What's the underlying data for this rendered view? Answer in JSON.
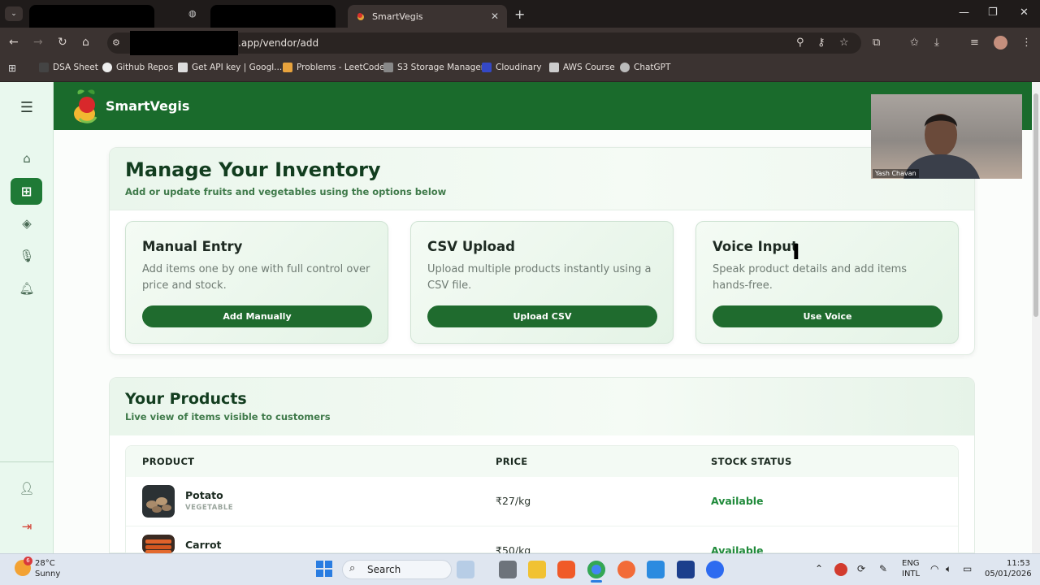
{
  "browser": {
    "tabs": [
      {
        "label": ""
      },
      {
        "label": ""
      },
      {
        "label": "SmartVegis"
      }
    ],
    "url": ".app/vendor/add",
    "bookmarks": [
      "DSA Sheet",
      "Github Repos",
      "Get API key | Googl...",
      "Problems - LeetCode",
      "S3 Storage Manager",
      "Cloudinary",
      "AWS Course",
      "ChatGPT"
    ]
  },
  "app": {
    "brand": "SmartVegis",
    "inventory": {
      "title": "Manage Your Inventory",
      "subtitle": "Add or update fruits and vegetables using the options below",
      "cards": [
        {
          "title": "Manual Entry",
          "desc": "Add items one by one with full control over price and stock.",
          "button": "Add Manually"
        },
        {
          "title": "CSV Upload",
          "desc": "Upload multiple products instantly using a CSV file.",
          "button": "Upload CSV"
        },
        {
          "title": "Voice Input",
          "desc": "Speak product details and add items hands-free.",
          "button": "Use Voice"
        }
      ]
    },
    "products": {
      "title": "Your Products",
      "subtitle": "Live view of items visible to customers",
      "columns": [
        "PRODUCT",
        "PRICE",
        "STOCK STATUS"
      ],
      "rows": [
        {
          "name": "Potato",
          "category": "VEGETABLE",
          "price": "₹27/kg",
          "stock": "Available"
        },
        {
          "name": "Carrot",
          "category": "",
          "price": "₹50/kg",
          "stock": "Available"
        }
      ]
    }
  },
  "webcam": {
    "name": "Yash Chavan"
  },
  "taskbar": {
    "weather_temp": "28°C",
    "weather_cond": "Sunny",
    "weather_badge": "6",
    "search": "Search",
    "lang1": "ENG",
    "lang2": "INTL",
    "time": "11:53",
    "date": "05/01/2026"
  },
  "colors": {
    "accent": "#1a6b2c",
    "button": "#1f6b2e",
    "available": "#1f8a3a"
  }
}
